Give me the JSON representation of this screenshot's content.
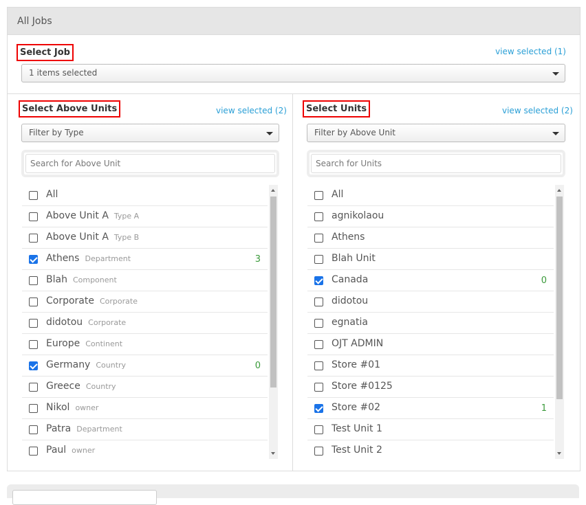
{
  "panel": {
    "title": "All Jobs"
  },
  "job": {
    "label": "Select Job",
    "view_selected": "view selected (1)",
    "dropdown_value": "1 items selected"
  },
  "above_units": {
    "label": "Select Above Units",
    "view_selected": "view selected (2)",
    "filter_value": "Filter by Type",
    "search_placeholder": "Search for Above Unit",
    "items": [
      {
        "name": "All",
        "type": "",
        "checked": false,
        "count": ""
      },
      {
        "name": "Above Unit A",
        "type": "Type A",
        "checked": false,
        "count": ""
      },
      {
        "name": "Above Unit A",
        "type": "Type B",
        "checked": false,
        "count": ""
      },
      {
        "name": "Athens",
        "type": "Department",
        "checked": true,
        "count": "3"
      },
      {
        "name": "Blah",
        "type": "Component",
        "checked": false,
        "count": ""
      },
      {
        "name": "Corporate",
        "type": "Corporate",
        "checked": false,
        "count": ""
      },
      {
        "name": "didotou",
        "type": "Corporate",
        "checked": false,
        "count": ""
      },
      {
        "name": "Europe",
        "type": "Continent",
        "checked": false,
        "count": ""
      },
      {
        "name": "Germany",
        "type": "Country",
        "checked": true,
        "count": "0"
      },
      {
        "name": "Greece",
        "type": "Country",
        "checked": false,
        "count": ""
      },
      {
        "name": "Nikol",
        "type": "owner",
        "checked": false,
        "count": ""
      },
      {
        "name": "Patra",
        "type": "Department",
        "checked": false,
        "count": ""
      },
      {
        "name": "Paul",
        "type": "owner",
        "checked": false,
        "count": ""
      }
    ]
  },
  "units": {
    "label": "Select Units",
    "view_selected": "view selected (2)",
    "filter_value": "Filter by Above Unit",
    "search_placeholder": "Search for Units",
    "items": [
      {
        "name": "All",
        "type": "",
        "checked": false,
        "count": ""
      },
      {
        "name": "agnikolaou",
        "type": "",
        "checked": false,
        "count": ""
      },
      {
        "name": "Athens",
        "type": "",
        "checked": false,
        "count": ""
      },
      {
        "name": "Blah Unit",
        "type": "",
        "checked": false,
        "count": ""
      },
      {
        "name": "Canada",
        "type": "",
        "checked": true,
        "count": "0"
      },
      {
        "name": "didotou",
        "type": "",
        "checked": false,
        "count": ""
      },
      {
        "name": "egnatia",
        "type": "",
        "checked": false,
        "count": ""
      },
      {
        "name": "OJT ADMIN",
        "type": "",
        "checked": false,
        "count": ""
      },
      {
        "name": "Store #01",
        "type": "",
        "checked": false,
        "count": ""
      },
      {
        "name": "Store #0125",
        "type": "",
        "checked": false,
        "count": ""
      },
      {
        "name": "Store #02",
        "type": "",
        "checked": true,
        "count": "1"
      },
      {
        "name": "Test Unit 1",
        "type": "",
        "checked": false,
        "count": ""
      },
      {
        "name": "Test Unit 2",
        "type": "",
        "checked": false,
        "count": ""
      }
    ]
  }
}
